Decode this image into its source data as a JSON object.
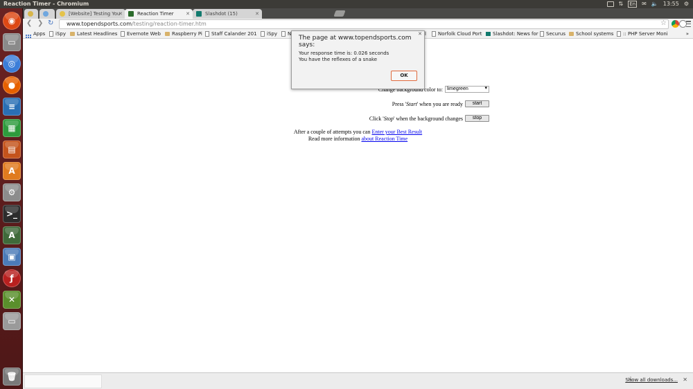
{
  "system": {
    "window_title": "Reaction Timer - Chromium",
    "keyboard_layout": "En",
    "clock": "13:55"
  },
  "launcher": {
    "items": [
      "dash-home",
      "files",
      "chromium",
      "firefox",
      "libreoffice-writer",
      "libreoffice-calc",
      "libreoffice-impress",
      "software-center",
      "system-settings",
      "terminal",
      "ubuntu-one",
      "remote-desktop",
      "flash-app",
      "crossover",
      "screenshot-app",
      "trash"
    ]
  },
  "browser": {
    "tabs": [
      {
        "label": "",
        "active": false
      },
      {
        "label": "",
        "active": false
      },
      {
        "label": "[Website] Testing You",
        "active": false
      },
      {
        "label": "Reaction Timer",
        "active": true
      },
      {
        "label": "Slashdot (15)",
        "active": false
      }
    ],
    "url": {
      "domain": "www.topendsports.com",
      "path": "/testing/reaction-timer.htm"
    },
    "bookmarks": [
      {
        "label": "Apps",
        "icon": "apps-icon"
      },
      {
        "label": "iSpy",
        "icon": "page-icon"
      },
      {
        "label": "Latest Headlines",
        "icon": "folder-icon"
      },
      {
        "label": "Evernote Web",
        "icon": "page-icon"
      },
      {
        "label": "Raspberry Pi",
        "icon": "folder-icon"
      },
      {
        "label": "Staff Calander 201",
        "icon": "page-icon"
      },
      {
        "label": "iSpy",
        "icon": "page-icon"
      },
      {
        "label": "N",
        "icon": "page-icon"
      },
      {
        "label": "il",
        "icon": "none"
      },
      {
        "label": "Norfolk Cloud Port",
        "icon": "page-icon"
      },
      {
        "label": "Slashdot: News for",
        "icon": "slashdot-icon"
      },
      {
        "label": "Securus",
        "icon": "page-icon"
      },
      {
        "label": "School systems",
        "icon": "folder-icon"
      },
      {
        "label": ":: PHP Server Moni",
        "icon": "page-icon"
      }
    ]
  },
  "page": {
    "bg_color_label": "Change background color to:",
    "bg_color_value": "limegreen",
    "start_prompt_pre": "Press '",
    "start_prompt_em": "Start",
    "start_prompt_post": "' when you are ready",
    "start_button": "start",
    "stop_prompt_pre": "Click '",
    "stop_prompt_em": "Stop",
    "stop_prompt_post": "' when the background changes",
    "stop_button": "stop",
    "attempts_text": "After a couple of attempts you can ",
    "attempts_link": "Enter your Best Result",
    "info_text": "Read more information ",
    "info_link": "about Reaction Time"
  },
  "dialog": {
    "title": "The page at www.topendsports.com says:",
    "line1": "Your response time is: 0.026 seconds",
    "line2": "You have the reflexes of a snake",
    "ok_button": "OK"
  },
  "download_shelf": {
    "show_all": "Show all downloads..."
  },
  "colors": {
    "launcher": "#5c1f1f",
    "panel": "#3c3b37",
    "dialog_ok_border": "#e0693c",
    "link": "#0000ee"
  }
}
